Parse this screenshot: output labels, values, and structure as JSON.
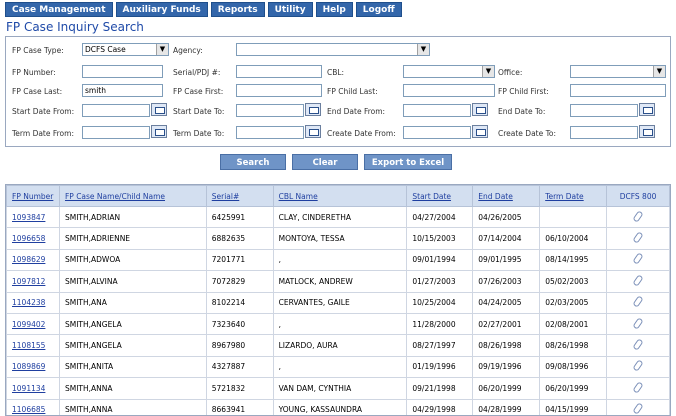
{
  "menu": [
    "Case Management",
    "Auxiliary Funds",
    "Reports",
    "Utility",
    "Help",
    "Logoff"
  ],
  "page_title": "FP Case Inquiry Search",
  "form": {
    "fp_case_type_label": "FP Case Type:",
    "fp_case_type_value": "DCFS Case",
    "agency_label": "Agency:",
    "agency_value": "",
    "fp_number_label": "FP Number:",
    "serial_label": "Serial/PDJ #:",
    "cbl_label": "CBL:",
    "office_label": "Office:",
    "fp_case_last_label": "FP Case Last:",
    "fp_case_last_value": "smith",
    "fp_case_first_label": "FP Case First:",
    "fp_child_last_label": "FP Child Last:",
    "fp_child_first_label": "FP Child First:",
    "start_date_from_label": "Start Date From:",
    "start_date_to_label": "Start Date To:",
    "end_date_from_label": "End Date From:",
    "end_date_to_label": "End Date To:",
    "term_date_from_label": "Term Date From:",
    "term_date_to_label": "Term Date To:",
    "create_date_from_label": "Create Date From:",
    "create_date_to_label": "Create Date To:"
  },
  "buttons": {
    "search": "Search",
    "clear": "Clear",
    "export": "Export to Excel"
  },
  "table": {
    "headers": [
      "FP Number",
      "FP Case Name/Child Name",
      "Serial#",
      "CBL Name",
      "Start Date",
      "End Date",
      "Term Date",
      "DCFS 800"
    ],
    "rows": [
      [
        "1093847",
        "SMITH,ADRIAN",
        "6425991",
        "CLAY, CINDERETHA",
        "04/27/2004",
        "04/26/2005",
        ""
      ],
      [
        "1096658",
        "SMITH,ADRIENNE",
        "6882635",
        "MONTOYA, TESSA",
        "10/15/2003",
        "07/14/2004",
        "06/10/2004"
      ],
      [
        "1098629",
        "SMITH,ADWOA",
        "7201771",
        ",",
        "09/01/1994",
        "09/01/1995",
        "08/14/1995"
      ],
      [
        "1097812",
        "SMITH,ALVINA",
        "7072829",
        "MATLOCK, ANDREW",
        "01/27/2003",
        "07/26/2003",
        "05/02/2003"
      ],
      [
        "1104238",
        "SMITH,ANA",
        "8102214",
        "CERVANTES, GAILE",
        "10/25/2004",
        "04/24/2005",
        "02/03/2005"
      ],
      [
        "1099402",
        "SMITH,ANGELA",
        "7323640",
        ",",
        "11/28/2000",
        "02/27/2001",
        "02/08/2001"
      ],
      [
        "1108155",
        "SMITH,ANGELA",
        "8967980",
        "LIZARDO, AURA",
        "08/27/1997",
        "08/26/1998",
        "08/26/1998"
      ],
      [
        "1089869",
        "SMITH,ANITA",
        "4327887",
        ",",
        "01/19/1996",
        "09/19/1996",
        "09/08/1996"
      ],
      [
        "1091134",
        "SMITH,ANNA",
        "5721832",
        "VAN DAM, CYNTHIA",
        "09/21/1998",
        "06/20/1999",
        "06/20/1999"
      ],
      [
        "1106685",
        "SMITH,ANNA",
        "8663941",
        "YOUNG, KASSAUNDRA",
        "04/29/1998",
        "04/28/1999",
        "04/15/1999"
      ]
    ]
  }
}
